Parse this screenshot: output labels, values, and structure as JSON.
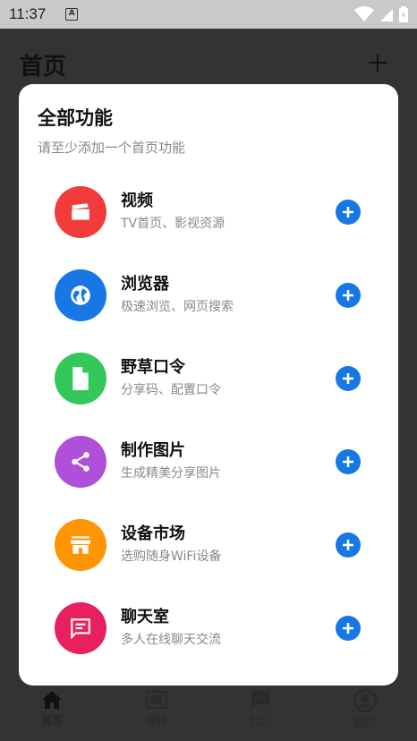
{
  "status_bar": {
    "time": "11:37",
    "notif_letter": "A"
  },
  "header": {
    "title": "首页"
  },
  "modal": {
    "title": "全部功能",
    "subtitle": "请至少添加一个首页功能",
    "features": [
      {
        "name": "视频",
        "desc": "TV首页、影视资源",
        "icon": "clapperboard-icon",
        "color": "#f23c3c"
      },
      {
        "name": "浏览器",
        "desc": "极速浏览、网页搜索",
        "icon": "globe-icon",
        "color": "#1677e5"
      },
      {
        "name": "野草口令",
        "desc": "分享码、配置口令",
        "icon": "document-icon",
        "color": "#34c759"
      },
      {
        "name": "制作图片",
        "desc": "生成精美分享图片",
        "icon": "share-icon",
        "color": "#b04fd9"
      },
      {
        "name": "设备市场",
        "desc": "选购随身WiFi设备",
        "icon": "store-icon",
        "color": "#ff9500"
      },
      {
        "name": "聊天室",
        "desc": "多人在线聊天交流",
        "icon": "chat-icon",
        "color": "#e8205f"
      }
    ],
    "add_button_color": "#1677e5"
  },
  "bottom_nav": [
    {
      "label": "首页",
      "icon": "home-icon"
    },
    {
      "label": "赚钱",
      "icon": "wallet-icon"
    },
    {
      "label": "社区",
      "icon": "chat-icon"
    },
    {
      "label": "我的",
      "icon": "user-icon"
    }
  ]
}
